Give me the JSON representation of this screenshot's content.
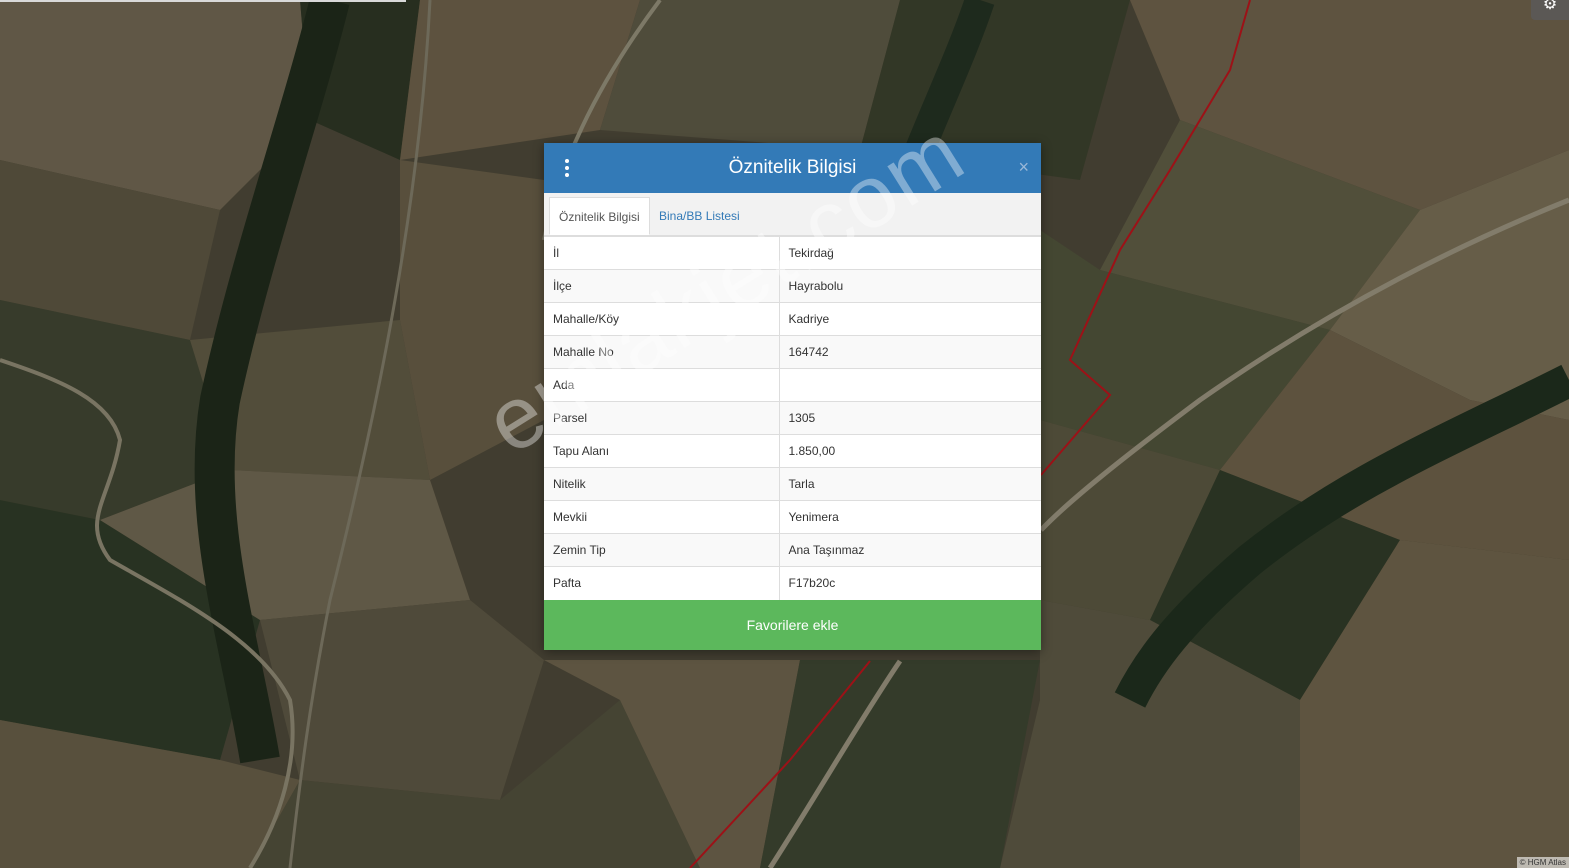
{
  "dialog": {
    "title": "Öznitelik Bilgisi",
    "close_symbol": "×",
    "menu_icon": "vertical-dots-icon",
    "tabs": [
      {
        "label": "Öznitelik Bilgisi",
        "active": true
      },
      {
        "label": "Bina/BB Listesi",
        "active": false
      }
    ],
    "rows": [
      {
        "label": "İl",
        "value": "Tekirdağ"
      },
      {
        "label": "İlçe",
        "value": "Hayrabolu"
      },
      {
        "label": "Mahalle/Köy",
        "value": "Kadriye"
      },
      {
        "label": "Mahalle No",
        "value": "164742"
      },
      {
        "label": "Ada",
        "value": ""
      },
      {
        "label": "Parsel",
        "value": "1305"
      },
      {
        "label": "Tapu Alanı",
        "value": "1.850,00"
      },
      {
        "label": "Nitelik",
        "value": "Tarla"
      },
      {
        "label": "Mevkii",
        "value": "Yenimera"
      },
      {
        "label": "Zemin Tip",
        "value": "Ana Taşınmaz"
      },
      {
        "label": "Pafta",
        "value": "F17b20c"
      }
    ],
    "favorite_button": "Favorilere ekle"
  },
  "map": {
    "attribution": "© HGM Atlas",
    "watermark": "emlakjet.com",
    "settings_icon": "gear-icon",
    "colors": {
      "header": "#337ab7",
      "favorite": "#5cb85c",
      "parcel_line": "#b3141b"
    }
  }
}
